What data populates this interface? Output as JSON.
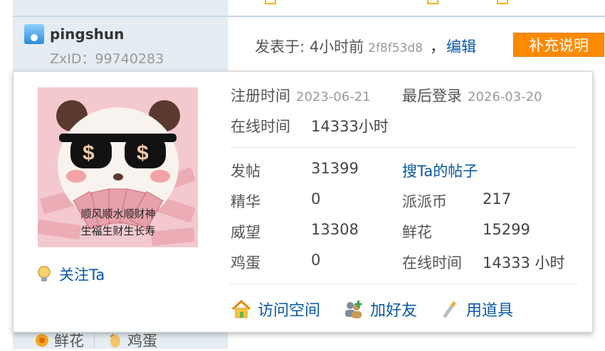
{
  "post": {
    "author": "pingshun",
    "zxid": "ZxID：99740283",
    "posted_label": "发表于: 4小时前",
    "post_hash": "2f8f53d8",
    "separator": "，",
    "edit_label": "编辑",
    "supplement_label": "补充说明"
  },
  "bottom_tabs": [
    {
      "label": "鲜花",
      "icon": "flower-icon"
    },
    {
      "label": "鸡蛋",
      "icon": "egg-icon"
    }
  ],
  "card": {
    "avatar_caption_line1": "顺风顺水顺财神",
    "avatar_caption_line2": "生福生财生长寿",
    "follow_label": "关注Ta",
    "register_label": "注册时间",
    "register_date": "2023-06-21",
    "last_login_label": "最后登录",
    "last_login_date": "2026-03-20",
    "online_label": "在线时间",
    "online_value": "14333小时",
    "stats": {
      "posts_label": "发帖",
      "posts_value": "31399",
      "search_posts_label": "搜Ta的帖子",
      "digest_label": "精华",
      "digest_value": "0",
      "paipai_label": "派派币",
      "paipai_value": "217",
      "prestige_label": "威望",
      "prestige_value": "13308",
      "flowers_label": "鲜花",
      "flowers_value": "15299",
      "eggs_label": "鸡蛋",
      "eggs_value": "0",
      "online2_label": "在线时间",
      "online2_value": "14333 小时"
    },
    "actions": [
      {
        "label": "访问空间",
        "icon": "home-icon"
      },
      {
        "label": "加好友",
        "icon": "add-friend-icon"
      },
      {
        "label": "用道具",
        "icon": "magic-wand-icon"
      }
    ]
  },
  "colors": {
    "link": "#0a58a5",
    "accent_button": "#ff8a00",
    "sidebar_bg": "#e5edf2"
  }
}
